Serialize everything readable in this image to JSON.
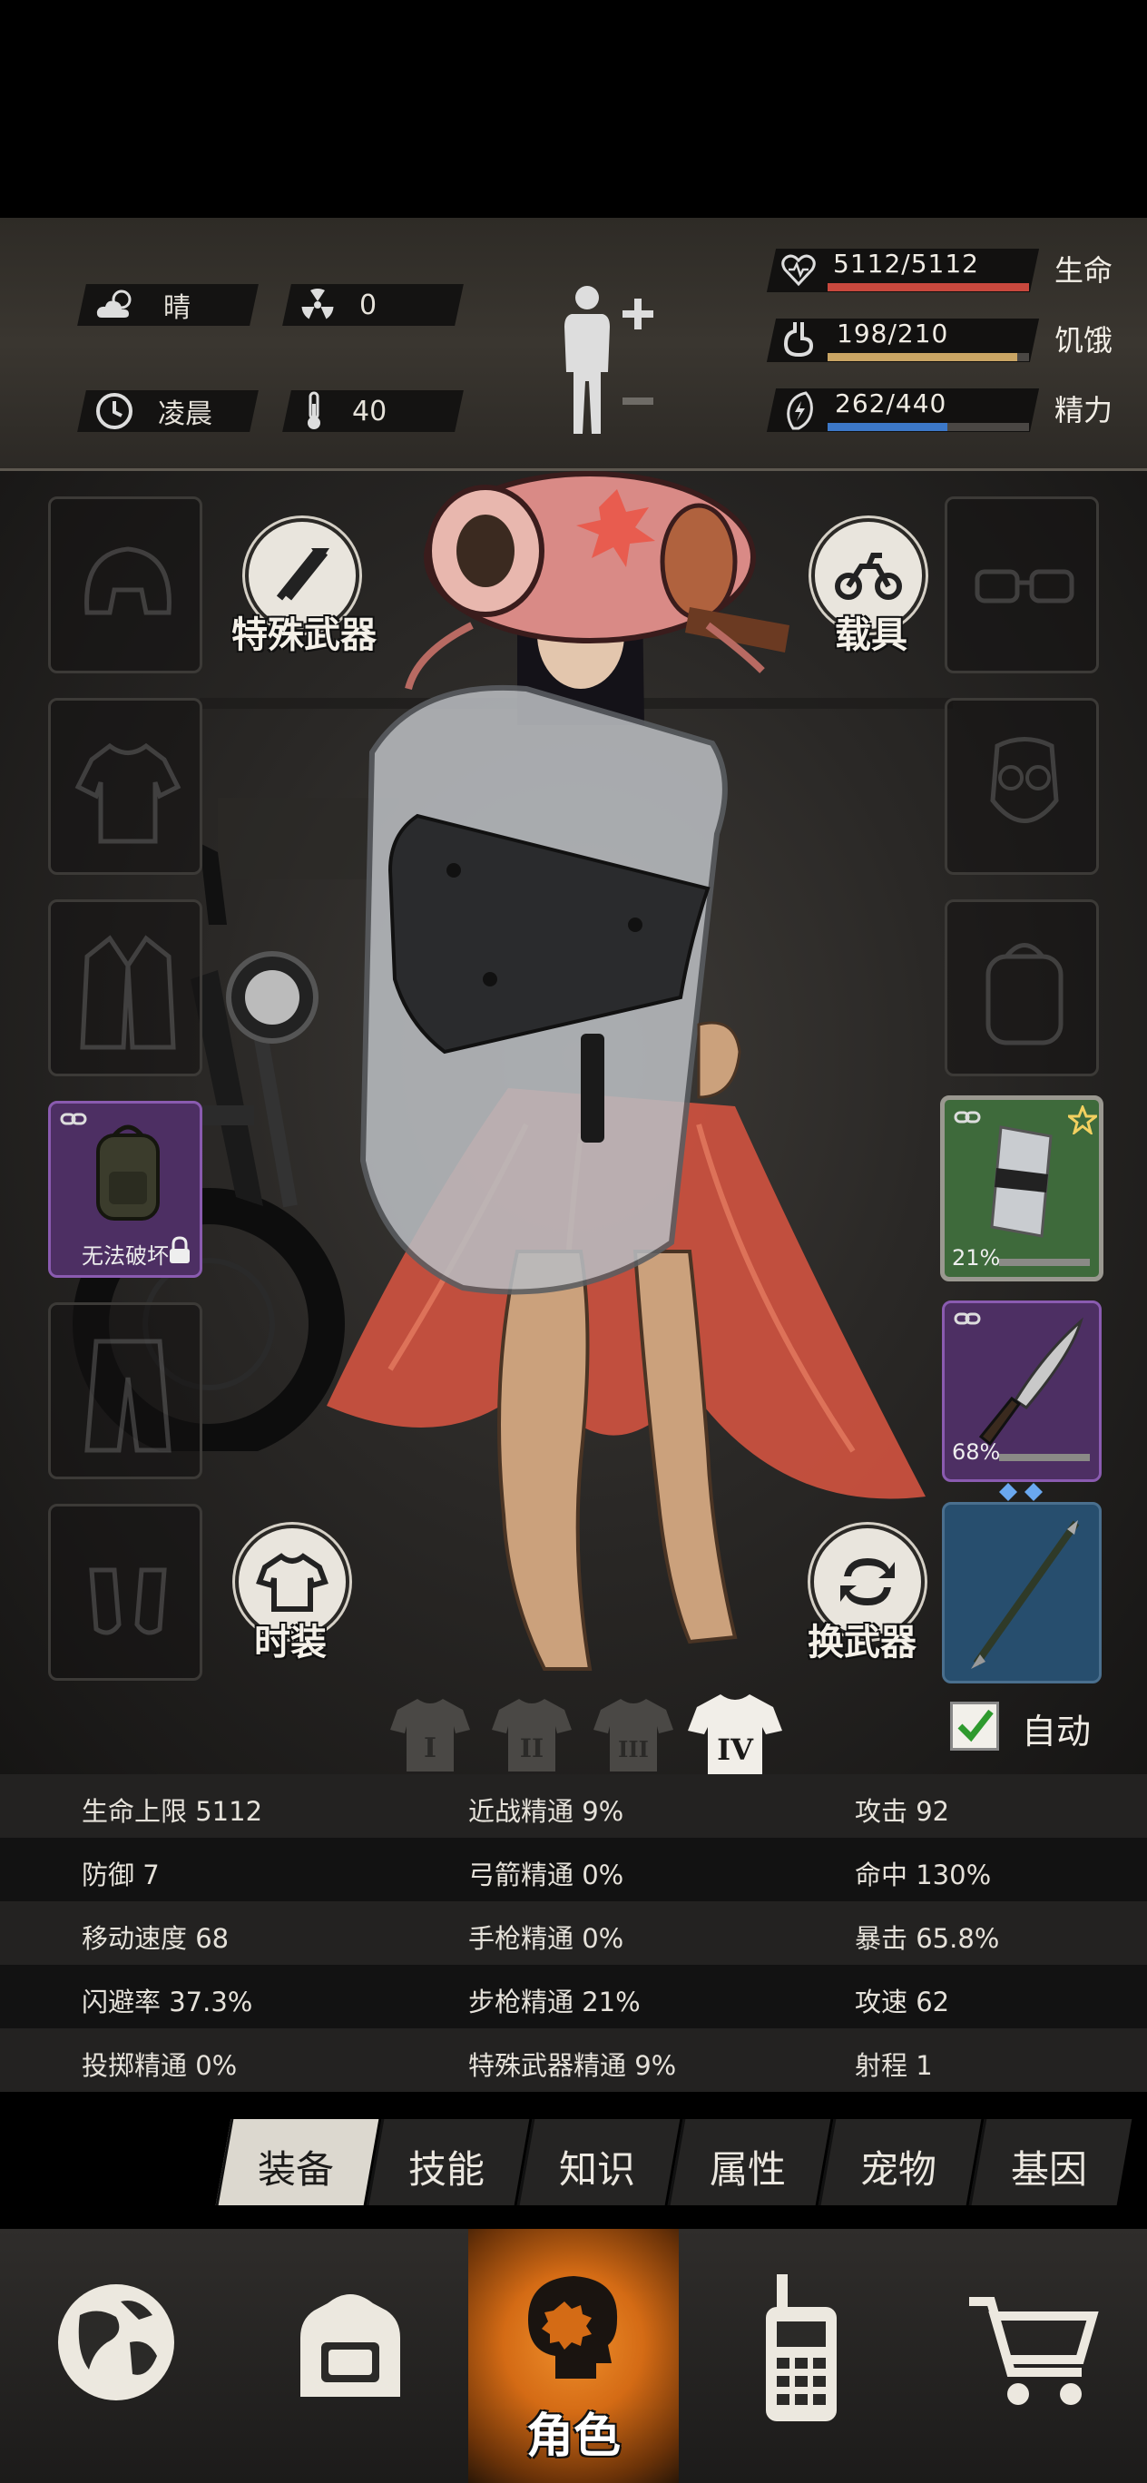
{
  "status": {
    "weather": {
      "icon": "cloud-sun-icon",
      "value": "晴"
    },
    "radiation": {
      "icon": "radiation-icon",
      "value": "0"
    },
    "time": {
      "icon": "clock-icon",
      "value": "凌晨"
    },
    "temperature": {
      "icon": "thermometer-icon",
      "value": "40"
    },
    "health": {
      "text": "5112/5112",
      "label": "生命",
      "fraction": 1.0,
      "color": "#c8483d"
    },
    "hunger": {
      "text": "198/210",
      "label": "饥饿",
      "fraction": 0.943,
      "color": "#c9a564"
    },
    "energy": {
      "text": "262/440",
      "label": "精力",
      "fraction": 0.595,
      "color": "#3c78c8"
    }
  },
  "buttons": {
    "special_weapon": "特殊武器",
    "vehicle": "载具",
    "fashion": "时装",
    "swap_weapon": "换武器"
  },
  "slots": {
    "backpack_note": "无法破坏",
    "shield_durability": "21%",
    "knife_durability": "68%"
  },
  "outfits": [
    "I",
    "II",
    "III",
    "IV"
  ],
  "auto": {
    "label": "自动",
    "checked": true
  },
  "stats": [
    [
      "生命上限 5112",
      "近战精通 9%",
      "攻击 92"
    ],
    [
      "防御 7",
      "弓箭精通 0%",
      "命中 130%"
    ],
    [
      "移动速度 68",
      "手枪精通 0%",
      "暴击 65.8%"
    ],
    [
      "闪避率 37.3%",
      "步枪精通 21%",
      "攻速 62"
    ],
    [
      "投掷精通 0%",
      "特殊武器精通 9%",
      "射程 1"
    ]
  ],
  "tabs": [
    "装备",
    "技能",
    "知识",
    "属性",
    "宠物",
    "基因"
  ],
  "nav": {
    "character_label": "角色"
  },
  "colors": {
    "epic_purple": "#6a3a8a",
    "rare_green": "#3f6a3a",
    "blue_slot": "#274e6e",
    "accent_orange": "#e07a1f"
  }
}
